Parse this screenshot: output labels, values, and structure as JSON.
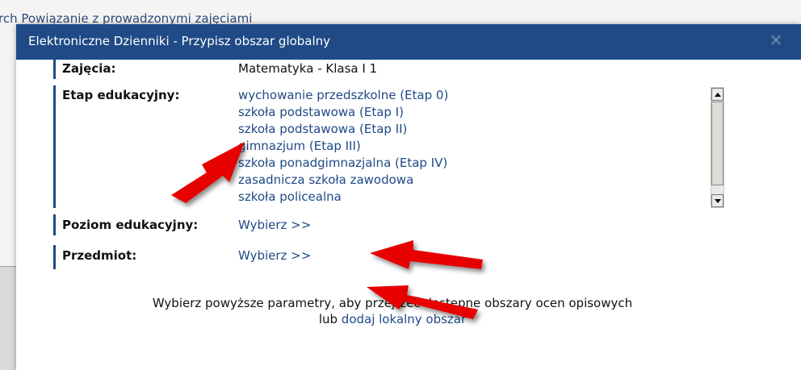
{
  "background": {
    "breadcrumb": "rch   Powiązanie z prowadzonymi zajęciami"
  },
  "modal": {
    "title": "Elektroniczne Dzienniki - Przypisz obszar globalny",
    "close_symbol": "×"
  },
  "form": {
    "zajecia": {
      "label": "Zajęcia:",
      "value": "Matematyka - Klasa I 1"
    },
    "etap": {
      "label": "Etap edukacyjny:",
      "options": [
        "wychowanie przedszkolne (Etap 0)",
        "szkoła podstawowa (Etap I)",
        "szkoła podstawowa (Etap II)",
        "gimnazjum (Etap III)",
        "szkoła ponadgimnazjalna (Etap IV)",
        "zasadnicza szkoła zawodowa",
        "szkoła policealna"
      ]
    },
    "poziom": {
      "label": "Poziom edukacyjny:",
      "link": "Wybierz >>"
    },
    "przedmiot": {
      "label": "Przedmiot:",
      "link": "Wybierz >>"
    }
  },
  "footer": {
    "text_line1": "Wybierz powyższe parametry, aby przejrzeć dostępne obszary ocen opisowych",
    "text_line2_prefix": "lub ",
    "text_line2_link": "dodaj lokalny obszar"
  },
  "colors": {
    "header": "#1f4a86",
    "link": "#1f4a86",
    "annotation_arrow": "#e60000"
  },
  "icons": [
    "close-icon",
    "scroll-up-icon",
    "scroll-down-icon",
    "red-arrow-annotation"
  ]
}
